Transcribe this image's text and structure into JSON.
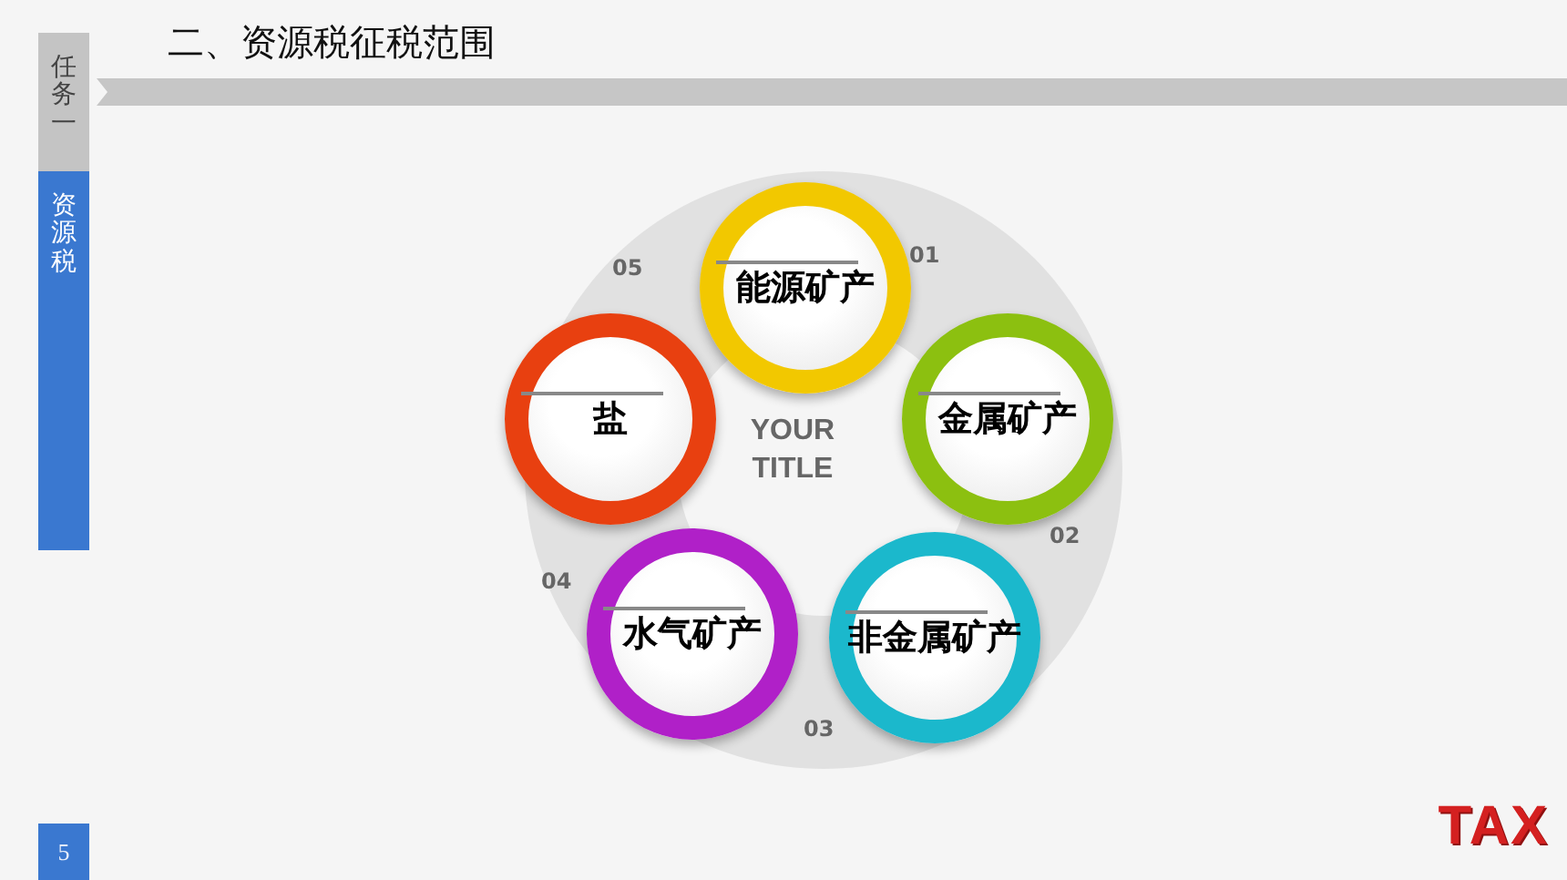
{
  "sidebar": {
    "tabs": [
      {
        "label": "任务一",
        "selected": false
      },
      {
        "label": "资源税",
        "selected": true
      }
    ]
  },
  "title": "二、资源税征税范围",
  "diagram": {
    "center_title": "YOUR TITLE",
    "items": [
      {
        "number": "01",
        "label": "能源矿产",
        "color": "#f2c800"
      },
      {
        "number": "02",
        "label": "金属矿产",
        "color": "#8cc010"
      },
      {
        "number": "03",
        "label": "非金属矿产",
        "color": "#1bb8cc"
      },
      {
        "number": "04",
        "label": "水气矿产",
        "color": "#b020c8"
      },
      {
        "number": "05",
        "label": "盐",
        "color": "#e84010"
      }
    ]
  },
  "page_number": "5",
  "logo": "TAX"
}
